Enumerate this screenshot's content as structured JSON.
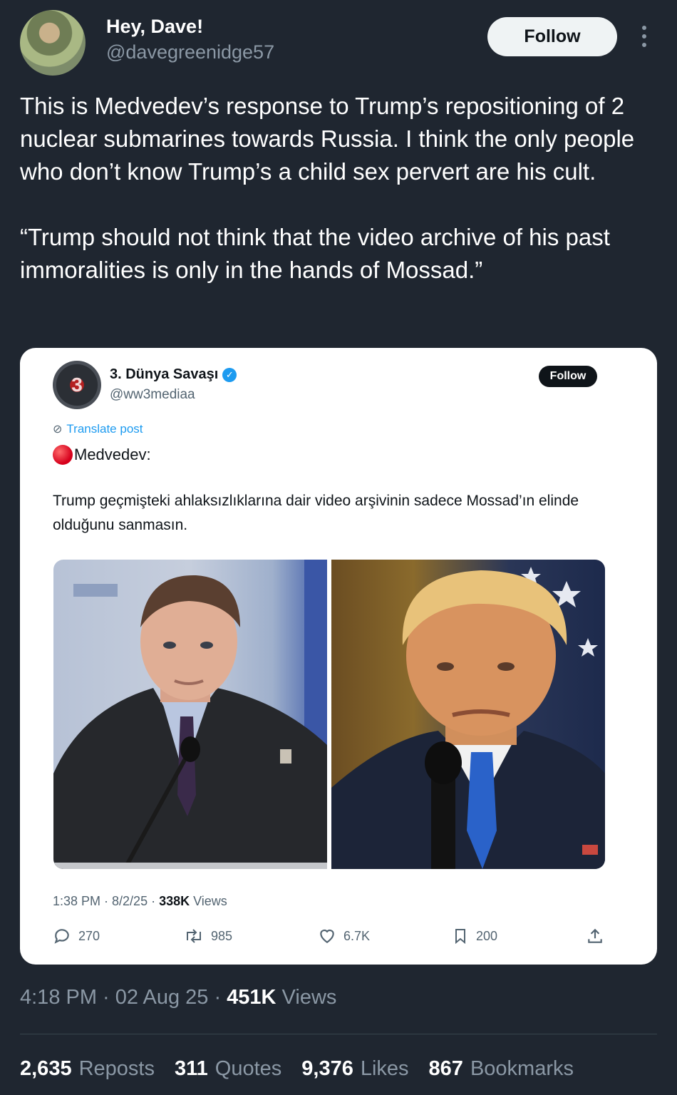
{
  "author": {
    "display_name": "Hey, Dave!",
    "handle": "@davegreenidge57",
    "follow_label": "Follow"
  },
  "tweet": {
    "paragraph1": "This is Medvedev’s response to Trump’s repositioning of 2 nuclear submarines towards Russia. I think the only people who don’t know Trump’s a child sex pervert are his cult.",
    "paragraph2": "“Trump should not think that the video archive of his past immoralities is only in the hands of Mossad.”"
  },
  "quoted": {
    "avatar_text": "3",
    "display_name": "3. Dünya Savaşı",
    "handle": "@ww3mediaa",
    "follow_label": "Follow",
    "translate_label": "Translate post",
    "title": "Medvedev:",
    "body": "Trump geçmişteki ahlaksızlıklarına dair video arşivinin sadece Mossad’ın elinde olduğunu sanmasın.",
    "meta_time": "1:38 PM · 8/2/25 · ",
    "meta_views_count": "338K",
    "meta_views_label": " Views",
    "replies": "270",
    "reposts": "985",
    "likes": "6.7K",
    "bookmarks": "200"
  },
  "footer": {
    "time": "4:18 PM · 02 Aug 25 · ",
    "views_count": "451K",
    "views_label": " Views",
    "reposts_count": "2,635",
    "reposts_label": "Reposts",
    "quotes_count": "311",
    "quotes_label": "Quotes",
    "likes_count": "9,376",
    "likes_label": "Likes",
    "bookmarks_count": "867",
    "bookmarks_label": "Bookmarks"
  },
  "colors": {
    "background": "#1f2630",
    "accent": "#1d9bf0",
    "muted": "#8b98a5"
  },
  "icons": [
    "more-icon",
    "verified-badge-icon",
    "translate-icon",
    "red-circle-icon",
    "reply-icon",
    "repost-icon",
    "like-icon",
    "bookmark-icon",
    "share-icon"
  ]
}
